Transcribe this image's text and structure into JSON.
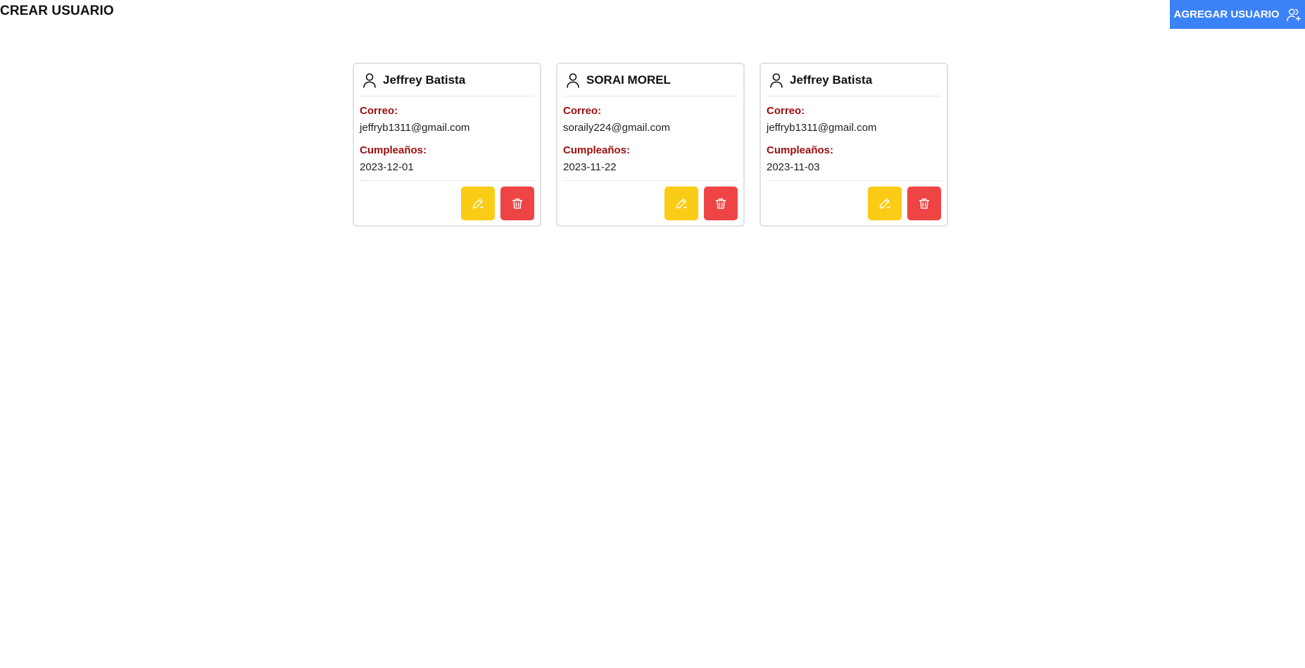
{
  "header": {
    "title": "CREAR USUARIO",
    "add_button_label": "AGREGAR USUARIO",
    "add_button_icon": "user-plus-icon",
    "add_button_color": "#3b82f6"
  },
  "labels": {
    "email": "Correo:",
    "birthday": "Cumpleaños:"
  },
  "users": [
    {
      "name": "Jeffrey Batista",
      "email": "jeffryb1311@gmail.com",
      "birthday": "2023-12-01"
    },
    {
      "name": "SORAI MOREL",
      "email": "soraily224@gmail.com",
      "birthday": "2023-11-22"
    },
    {
      "name": "Jeffrey Batista",
      "email": "jeffryb1311@gmail.com",
      "birthday": "2023-11-03"
    }
  ],
  "actions": {
    "edit_icon": "pencil-icon",
    "edit_color": "#facc15",
    "delete_icon": "trash-icon",
    "delete_color": "#ef4444"
  },
  "colors": {
    "label": "#9b0d0d"
  }
}
